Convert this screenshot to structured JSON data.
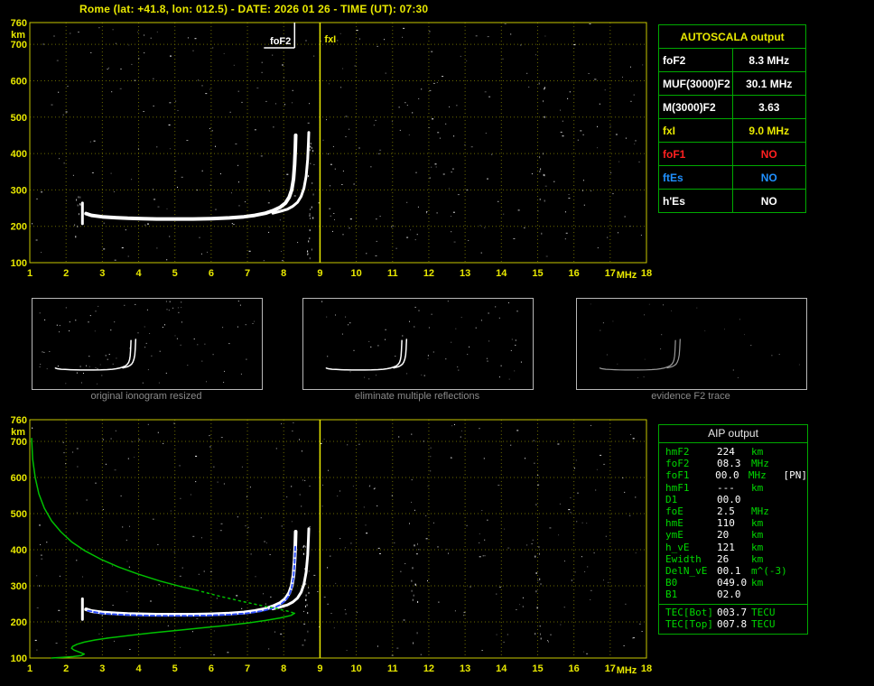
{
  "title": "Rome (lat: +41.8, lon: 012.5) - DATE: 2026 01 26 - TIME (UT): 07:30",
  "colors": {
    "axis": "#e8e800",
    "grid": "#6a6a00",
    "border": "#c8c800",
    "table_border": "#00aa00",
    "trace": "#ffffff",
    "profile": "#00c000",
    "fitted": "#3050ff",
    "caption": "#8a8a8a",
    "status_no": "#ff2020",
    "status_es": "#2090ff"
  },
  "autoscala_table": {
    "header": "AUTOSCALA output",
    "rows": [
      {
        "param": "foF2",
        "value": "8.3 MHz",
        "color": "#ffffff"
      },
      {
        "param": "MUF(3000)F2",
        "value": "30.1 MHz",
        "color": "#ffffff"
      },
      {
        "param": "M(3000)F2",
        "value": "3.63",
        "color": "#ffffff"
      },
      {
        "param": "fxI",
        "value": "9.0 MHz",
        "color": "#e8e800"
      },
      {
        "param": "foF1",
        "value": "NO",
        "color": "#ff2020"
      },
      {
        "param": "ftEs",
        "value": "NO",
        "color": "#2090ff"
      },
      {
        "param": "h'Es",
        "value": "NO",
        "color": "#ffffff"
      }
    ]
  },
  "aip_table": {
    "header": "AIP output",
    "rows": [
      {
        "param": "hmF2",
        "value": "224",
        "unit": "km",
        "extra": ""
      },
      {
        "param": "foF2",
        "value": "08.3",
        "unit": "MHz",
        "extra": ""
      },
      {
        "param": "foF1",
        "value": "00.0",
        "unit": "MHz",
        "extra": "[PN]"
      },
      {
        "param": "hmF1",
        "value": "---",
        "unit": "km",
        "extra": ""
      },
      {
        "param": "D1",
        "value": "00.0",
        "unit": "",
        "extra": ""
      },
      {
        "param": "foE",
        "value": "2.5",
        "unit": "MHz",
        "extra": ""
      },
      {
        "param": "hmE",
        "value": "110",
        "unit": "km",
        "extra": ""
      },
      {
        "param": "ymE",
        "value": "20",
        "unit": "km",
        "extra": ""
      },
      {
        "param": "h_vE",
        "value": "121",
        "unit": "km",
        "extra": ""
      },
      {
        "param": "Ewidth",
        "value": "26",
        "unit": "km",
        "extra": ""
      },
      {
        "param": "DelN_vE",
        "value": "00.1",
        "unit": "m^(-3)",
        "extra": ""
      },
      {
        "param": "B0",
        "value": "049.0",
        "unit": "km",
        "extra": ""
      },
      {
        "param": "B1",
        "value": "02.0",
        "unit": "",
        "extra": ""
      }
    ],
    "tec_rows": [
      {
        "param": "TEC[Bot]",
        "value": "003.7",
        "unit": "TECU",
        "extra": ""
      },
      {
        "param": "TEC[Top]",
        "value": "007.8",
        "unit": "TECU",
        "extra": ""
      }
    ]
  },
  "thumbnails": [
    {
      "caption": "original ionogram resized"
    },
    {
      "caption": "eliminate multiple reflections"
    },
    {
      "caption": "evidence F2 trace"
    }
  ],
  "chart_data": [
    {
      "name": "top-ionogram",
      "type": "scatter",
      "title": "",
      "xlabel": "MHz",
      "ylabel": "km",
      "xlim": [
        1,
        18
      ],
      "ylim": [
        100,
        760
      ],
      "x_ticks": [
        1,
        2,
        3,
        4,
        5,
        6,
        7,
        8,
        9,
        10,
        11,
        12,
        13,
        14,
        15,
        16,
        17,
        18
      ],
      "y_ticks": [
        100,
        200,
        300,
        400,
        500,
        600,
        700,
        760
      ],
      "grid": true,
      "markers": [
        {
          "label": "foF2",
          "x": 8.3,
          "color": "#ffffff",
          "style": "partial"
        },
        {
          "label": "fxI",
          "x": 9.0,
          "color": "#e8e800",
          "style": "full"
        }
      ],
      "series": [
        {
          "name": "echo-start-spread",
          "color": "#ffffff",
          "width": 3,
          "points": [
            [
              2.45,
              207
            ],
            [
              2.45,
              264
            ]
          ]
        },
        {
          "name": "o-mode-trace",
          "color": "#ffffff",
          "width": 4,
          "points": [
            [
              2.55,
              235
            ],
            [
              2.7,
              230
            ],
            [
              3.0,
              226
            ],
            [
              3.3,
              224
            ],
            [
              3.7,
              222
            ],
            [
              4.1,
              221
            ],
            [
              4.5,
              220
            ],
            [
              5.0,
              220
            ],
            [
              5.5,
              220
            ],
            [
              6.0,
              221
            ],
            [
              6.5,
              223
            ],
            [
              6.9,
              226
            ],
            [
              7.2,
              230
            ],
            [
              7.5,
              236
            ],
            [
              7.7,
              243
            ],
            [
              7.9,
              252
            ],
            [
              8.05,
              264
            ],
            [
              8.15,
              280
            ],
            [
              8.22,
              300
            ],
            [
              8.27,
              330
            ],
            [
              8.3,
              370
            ],
            [
              8.32,
              415
            ],
            [
              8.33,
              450
            ]
          ]
        },
        {
          "name": "x-mode-trace",
          "color": "#ffffff",
          "width": 3,
          "points": [
            [
              7.7,
              236
            ],
            [
              7.9,
              241
            ],
            [
              8.1,
              247
            ],
            [
              8.25,
              255
            ],
            [
              8.38,
              266
            ],
            [
              8.48,
              282
            ],
            [
              8.56,
              305
            ],
            [
              8.62,
              338
            ],
            [
              8.66,
              385
            ],
            [
              8.68,
              430
            ],
            [
              8.69,
              458
            ]
          ]
        }
      ]
    },
    {
      "name": "bottom-ionogram-with-profile",
      "type": "scatter",
      "title": "",
      "xlabel": "MHz",
      "ylabel": "km",
      "xlim": [
        1,
        18
      ],
      "ylim": [
        100,
        760
      ],
      "x_ticks": [
        1,
        2,
        3,
        4,
        5,
        6,
        7,
        8,
        9,
        10,
        11,
        12,
        13,
        14,
        15,
        16,
        17,
        18
      ],
      "y_ticks": [
        100,
        200,
        300,
        400,
        500,
        600,
        700,
        760
      ],
      "grid": true,
      "markers": [
        {
          "label": "",
          "x": 9.0,
          "color": "#e8e800",
          "style": "full"
        }
      ],
      "series": [
        {
          "name": "echo-start-spread",
          "color": "#ffffff",
          "width": 3,
          "points": [
            [
              2.45,
              207
            ],
            [
              2.45,
              264
            ]
          ]
        },
        {
          "name": "o-mode-trace",
          "color": "#ffffff",
          "width": 4,
          "points": [
            [
              2.55,
              235
            ],
            [
              2.7,
              230
            ],
            [
              3.0,
              226
            ],
            [
              3.3,
              224
            ],
            [
              3.7,
              222
            ],
            [
              4.1,
              221
            ],
            [
              4.5,
              220
            ],
            [
              5.0,
              220
            ],
            [
              5.5,
              220
            ],
            [
              6.0,
              221
            ],
            [
              6.5,
              223
            ],
            [
              6.9,
              226
            ],
            [
              7.2,
              230
            ],
            [
              7.5,
              236
            ],
            [
              7.7,
              243
            ],
            [
              7.9,
              252
            ],
            [
              8.05,
              264
            ],
            [
              8.15,
              280
            ],
            [
              8.22,
              300
            ],
            [
              8.27,
              330
            ],
            [
              8.3,
              370
            ],
            [
              8.32,
              415
            ],
            [
              8.33,
              450
            ]
          ]
        },
        {
          "name": "x-mode-trace",
          "color": "#ffffff",
          "width": 3,
          "points": [
            [
              7.7,
              236
            ],
            [
              7.9,
              241
            ],
            [
              8.1,
              247
            ],
            [
              8.25,
              255
            ],
            [
              8.38,
              266
            ],
            [
              8.48,
              282
            ],
            [
              8.56,
              305
            ],
            [
              8.62,
              338
            ],
            [
              8.66,
              385
            ],
            [
              8.68,
              430
            ],
            [
              8.69,
              458
            ]
          ]
        },
        {
          "name": "autoscala-fitted-trace",
          "color": "#3050ff",
          "width": 2,
          "dash": "4 3",
          "points": [
            [
              2.6,
              231
            ],
            [
              3.0,
              223
            ],
            [
              3.5,
              220
            ],
            [
              4.0,
              218
            ],
            [
              4.5,
              217
            ],
            [
              5.0,
              217
            ],
            [
              5.5,
              217
            ],
            [
              6.0,
              218
            ],
            [
              6.5,
              220
            ],
            [
              7.0,
              224
            ],
            [
              7.4,
              230
            ],
            [
              7.7,
              238
            ],
            [
              7.9,
              247
            ],
            [
              8.05,
              259
            ],
            [
              8.15,
              274
            ],
            [
              8.22,
              295
            ],
            [
              8.27,
              325
            ],
            [
              8.3,
              365
            ],
            [
              8.32,
              410
            ]
          ]
        },
        {
          "name": "electron-density-profile-topside",
          "color": "#00c000",
          "width": 1.5,
          "points": [
            [
              1.05,
              708
            ],
            [
              1.08,
              650
            ],
            [
              1.15,
              600
            ],
            [
              1.25,
              555
            ],
            [
              1.4,
              515
            ],
            [
              1.6,
              480
            ],
            [
              1.85,
              450
            ],
            [
              2.15,
              422
            ],
            [
              2.5,
              398
            ],
            [
              2.95,
              374
            ],
            [
              3.45,
              352
            ],
            [
              4.0,
              332
            ],
            [
              4.6,
              313
            ],
            [
              5.2,
              297
            ],
            [
              5.6,
              288
            ]
          ]
        },
        {
          "name": "electron-density-profile-near-peak",
          "color": "#00c000",
          "width": 1.5,
          "dash": "2 4",
          "points": [
            [
              5.6,
              288
            ],
            [
              6.2,
              272
            ],
            [
              6.8,
              258
            ],
            [
              7.3,
              247
            ],
            [
              7.8,
              237
            ],
            [
              8.1,
              230
            ],
            [
              8.3,
              224
            ]
          ]
        },
        {
          "name": "electron-density-profile-bottomside",
          "color": "#00c000",
          "width": 1.5,
          "points": [
            [
              8.3,
              224
            ],
            [
              8.2,
              218
            ],
            [
              7.9,
              211
            ],
            [
              7.5,
              204
            ],
            [
              7.0,
              197
            ],
            [
              6.4,
              190
            ],
            [
              5.8,
              184
            ],
            [
              5.1,
              177
            ],
            [
              4.4,
              170
            ],
            [
              3.8,
              163
            ],
            [
              3.2,
              156
            ],
            [
              2.8,
              150
            ],
            [
              2.5,
              144
            ],
            [
              2.3,
              138
            ],
            [
              2.18,
              132
            ],
            [
              2.15,
              127
            ],
            [
              2.22,
              122
            ],
            [
              2.35,
              117
            ],
            [
              2.5,
              111
            ],
            [
              2.42,
              107
            ],
            [
              2.2,
              104
            ],
            [
              1.9,
              102
            ],
            [
              1.6,
              100
            ]
          ]
        }
      ]
    }
  ]
}
